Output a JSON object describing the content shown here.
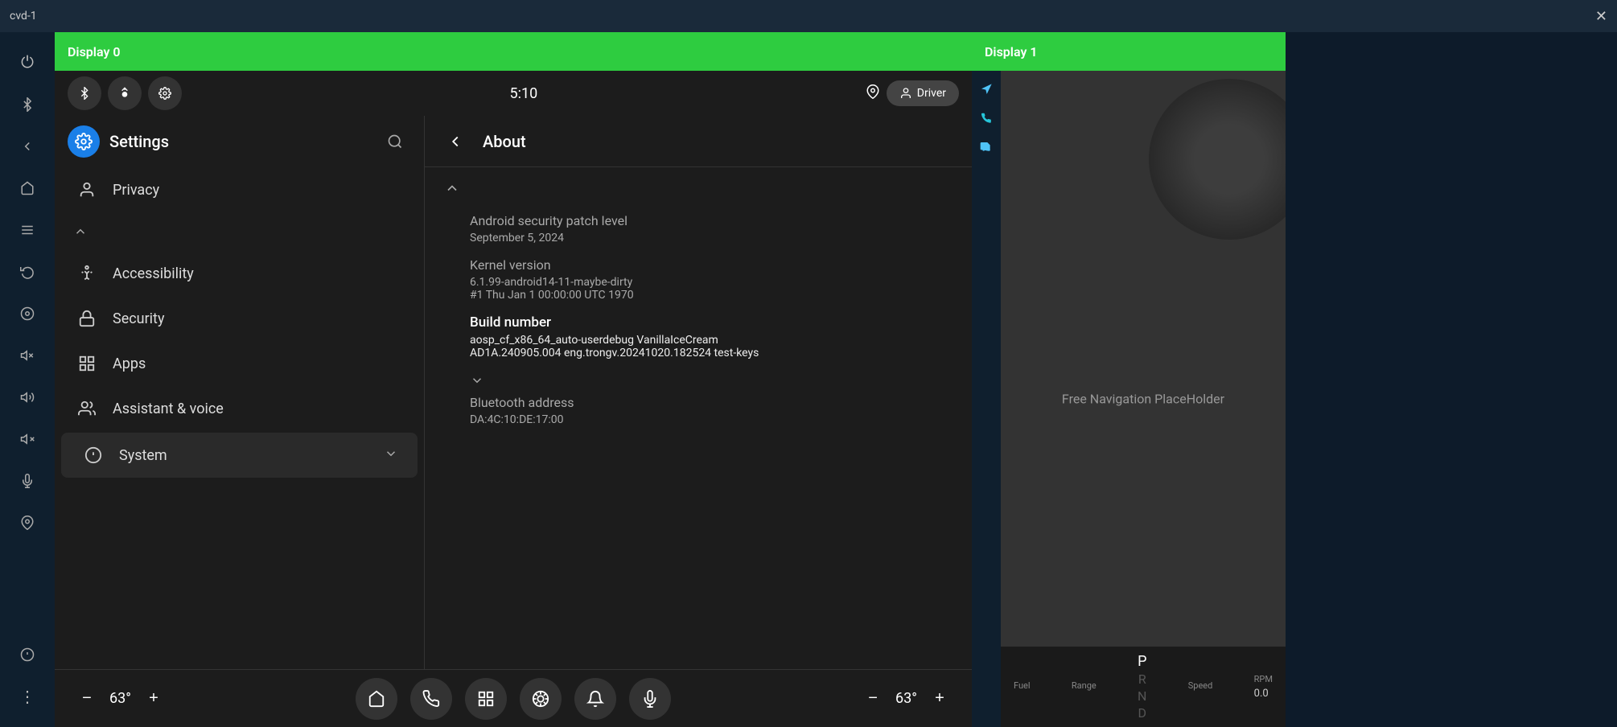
{
  "titleBar": {
    "title": "cvd-1",
    "closeLabel": "✕"
  },
  "displays": {
    "display0Label": "Display 0",
    "display1Label": "Display 1"
  },
  "statusBar": {
    "time": "5:10",
    "driverLabel": "Driver",
    "icons": {
      "bluetooth": "bluetooth-icon",
      "signal": "signal-icon",
      "settings": "settings-status-icon",
      "location": "location-icon"
    }
  },
  "settingsSidebar": {
    "title": "Settings",
    "searchIcon": "🔍",
    "items": [
      {
        "id": "privacy",
        "label": "Privacy",
        "icon": "👤"
      },
      {
        "id": "accessibility",
        "label": "Accessibility",
        "icon": "♿"
      },
      {
        "id": "security",
        "label": "Security",
        "icon": "🔒"
      },
      {
        "id": "apps",
        "label": "Apps",
        "icon": "⋮⋮"
      },
      {
        "id": "assistant",
        "label": "Assistant & voice",
        "icon": "👥"
      },
      {
        "id": "system",
        "label": "System",
        "icon": "ℹ️",
        "active": true
      }
    ]
  },
  "aboutPanel": {
    "backLabel": "←",
    "title": "About",
    "sections": [
      {
        "expanded": true,
        "items": [
          {
            "label": "Android security patch level",
            "value": "September 5, 2024",
            "bold": false
          },
          {
            "label": "Kernel version",
            "value": "6.1.99-android14-11-maybe-dirty\n#1 Thu Jan  1 00:00:00 UTC 1970",
            "bold": false
          },
          {
            "label": "Build number",
            "value": "aosp_cf_x86_64_auto-userdebug VanillaIceCream\nAD1A.240905.004 eng.trongv.20241020.182524 test-keys",
            "bold": true
          },
          {
            "label": "Bluetooth address",
            "value": "DA:4C:10:DE:17:00",
            "bold": false
          }
        ]
      }
    ]
  },
  "bottomBar": {
    "tempLeft": "63°",
    "tempRight": "63°",
    "minusLabel": "−",
    "plusLabel": "+",
    "buttons": [
      {
        "id": "home",
        "icon": "⌂",
        "label": "home-button"
      },
      {
        "id": "phone",
        "icon": "📞",
        "label": "phone-button"
      },
      {
        "id": "grid",
        "icon": "⊞",
        "label": "grid-button"
      },
      {
        "id": "fan",
        "icon": "❄",
        "label": "fan-button"
      },
      {
        "id": "bell",
        "icon": "🔔",
        "label": "bell-button"
      },
      {
        "id": "mic",
        "icon": "🎤",
        "label": "mic-button"
      }
    ]
  },
  "display1": {
    "navPlaceholder": "Free Navigation PlaceHolder",
    "gauges": {
      "fuel": {
        "label": "Fuel",
        "value": ""
      },
      "range": {
        "label": "Range",
        "value": ""
      },
      "speed": {
        "label": "Speed",
        "value": ""
      },
      "rpm": {
        "label": "RPM",
        "value": "0.0"
      }
    },
    "gears": [
      "P",
      "R",
      "N",
      "D"
    ],
    "activeGear": "P"
  },
  "iconStrip": {
    "buttons": [
      {
        "id": "power",
        "icon": "⏻"
      },
      {
        "id": "bluetooth",
        "icon": "⚡"
      },
      {
        "id": "back",
        "icon": "←"
      },
      {
        "id": "home",
        "icon": "⌂"
      },
      {
        "id": "menu",
        "icon": "☰"
      },
      {
        "id": "recent",
        "icon": "↺"
      },
      {
        "id": "radio",
        "icon": "◎"
      },
      {
        "id": "volume-down",
        "icon": "🔊"
      },
      {
        "id": "volume-up",
        "icon": "🔉"
      },
      {
        "id": "mute",
        "icon": "🔇"
      },
      {
        "id": "mic2",
        "icon": "🎙"
      },
      {
        "id": "location2",
        "icon": "📍"
      },
      {
        "id": "info",
        "icon": "ℹ"
      },
      {
        "id": "more",
        "icon": "⋮"
      }
    ]
  }
}
